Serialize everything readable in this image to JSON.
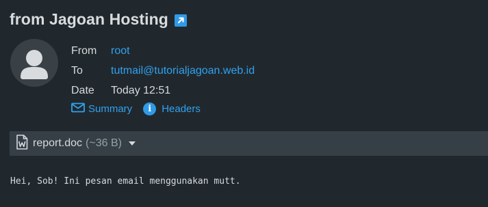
{
  "message": {
    "subject": "from Jagoan Hosting",
    "popout_icon": "external-link-icon"
  },
  "headers": {
    "from_label": "From",
    "from_value": "root",
    "to_label": "To",
    "to_value": "tutmail@tutorialjagoan.web.id",
    "date_label": "Date",
    "date_value": "Today 12:51"
  },
  "actions": {
    "summary_label": "Summary",
    "headers_label": "Headers",
    "summary_icon": "envelope-icon",
    "headers_icon": "info-icon"
  },
  "attachment": {
    "name": "report.doc",
    "size": "(~36 B)",
    "icon": "word-document-icon"
  },
  "body": {
    "text": "Hei, Sob! Ini pesan email menggunakan mutt."
  },
  "colors": {
    "background": "#21282d",
    "attachment_bar": "#363f45",
    "link": "#2fa2f0",
    "accent": "#2f9ae8"
  }
}
